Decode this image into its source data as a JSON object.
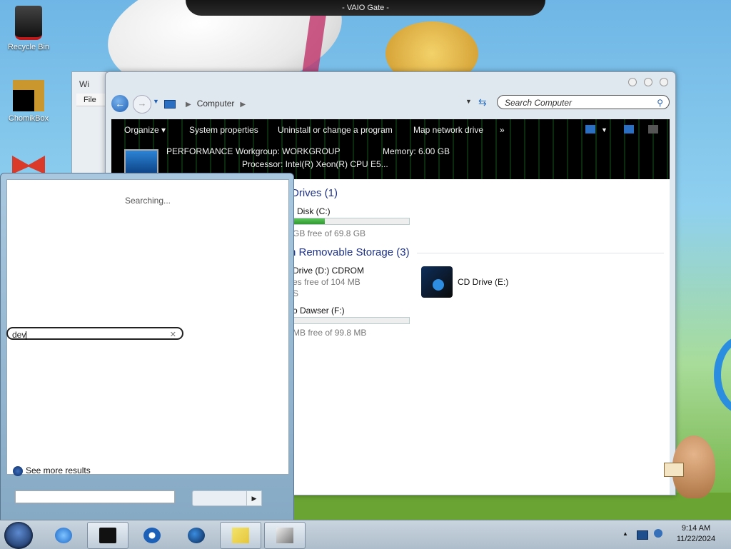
{
  "gate_title": "- VAIO Gate -",
  "desktop_icons": [
    {
      "label": "Recycle Bin",
      "icon": "recycle-bin-icon"
    },
    {
      "label": "ChomikBox",
      "icon": "chomikbox-icon"
    }
  ],
  "back_window": {
    "title": "Wi",
    "menu": "File"
  },
  "explorer": {
    "breadcrumb": "Computer",
    "search_placeholder": "Search Computer",
    "commands": [
      "Organize",
      "System properties",
      "Uninstall or change a program",
      "Map network drive",
      "»"
    ],
    "info": {
      "computer_name": "PERFORMANCE",
      "workgroup": "Workgroup: WORKGROUP",
      "memory": "Memory: 6.00 GB",
      "processor": "Processor: Intel(R) Xeon(R) CPU E5..."
    },
    "groups": {
      "hard_drives": "Drives (1)",
      "removable": "h Removable Storage (3)"
    },
    "items": {
      "disk_c": {
        "name": "l Disk (C:)",
        "free": "GB free of 69.8 GB",
        "usage": 0.28
      },
      "cd_d": {
        "name": "Drive (D:) CDROM",
        "free": "es free of 104 MB",
        "fs": "S"
      },
      "cd_e": {
        "name": "CD Drive (E:)",
        "icon": "cd-drive-icon"
      },
      "f": {
        "name": "o Dawser (F:)",
        "free": "MB free of 99.8 MB",
        "usage": 0.0
      }
    }
  },
  "start_menu": {
    "status": "Searching...",
    "see_more": "See more results",
    "search_value": "dev",
    "clear": "✕"
  },
  "taskbar": {
    "time": "9:14 AM",
    "date": "11/22/2024",
    "buttons": [
      "internet-explorer-icon",
      "black-box-icon",
      "media-player-icon",
      "globe-icon",
      "sticky-notes-icon",
      "tools-icon"
    ]
  }
}
